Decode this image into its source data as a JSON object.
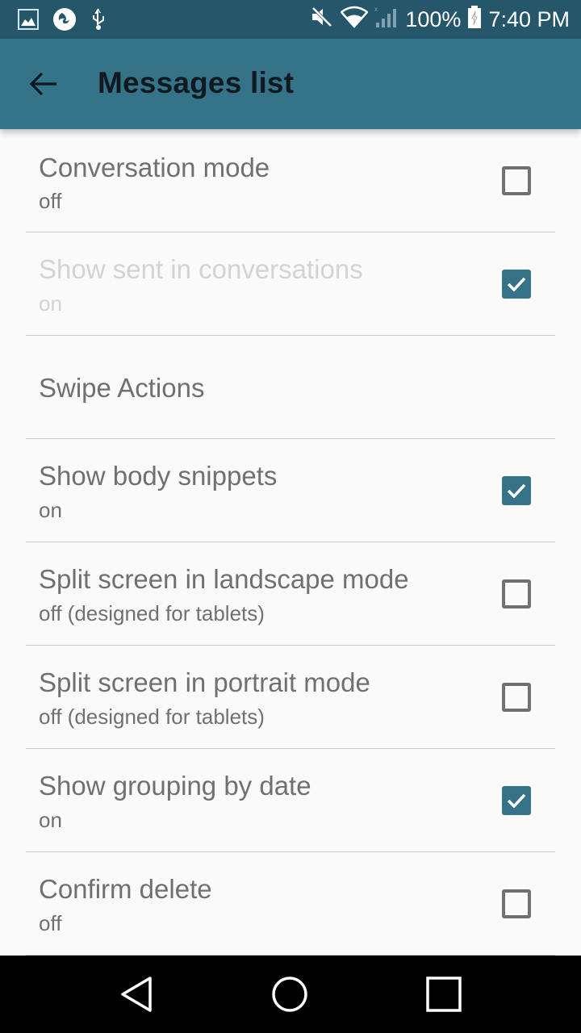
{
  "status_bar": {
    "left_icons": [
      "image-icon",
      "firefox-icon",
      "usb-icon"
    ],
    "right_icons": [
      "mute-icon",
      "wifi-icon",
      "signal-icon",
      "battery-charging-icon"
    ],
    "battery": "100%",
    "time": "7:40 PM"
  },
  "app_bar": {
    "back_icon": "arrow-back-icon",
    "title": "Messages list"
  },
  "settings": [
    {
      "title": "Conversation mode",
      "summary": "off",
      "checked": false,
      "enabled": true
    },
    {
      "title": "Show sent in conversations",
      "summary": "on",
      "checked": true,
      "enabled": false
    },
    {
      "title": "Swipe Actions",
      "summary": null,
      "checked": null,
      "enabled": true
    },
    {
      "title": "Show body snippets",
      "summary": "on",
      "checked": true,
      "enabled": true
    },
    {
      "title": "Split screen in landscape mode",
      "summary": "off (designed for tablets)",
      "checked": false,
      "enabled": true
    },
    {
      "title": "Split screen in portrait mode",
      "summary": "off (designed for tablets)",
      "checked": false,
      "enabled": true
    },
    {
      "title": "Show grouping by date",
      "summary": "on",
      "checked": true,
      "enabled": true
    },
    {
      "title": "Confirm delete",
      "summary": "off",
      "checked": false,
      "enabled": true
    }
  ],
  "colors": {
    "accent": "#357389",
    "status_bar": "#265669",
    "text": "#707070",
    "disabled_text": "#d3d3d3"
  },
  "nav_bar": {
    "icons": [
      "nav-back-icon",
      "nav-home-icon",
      "nav-recents-icon"
    ]
  }
}
